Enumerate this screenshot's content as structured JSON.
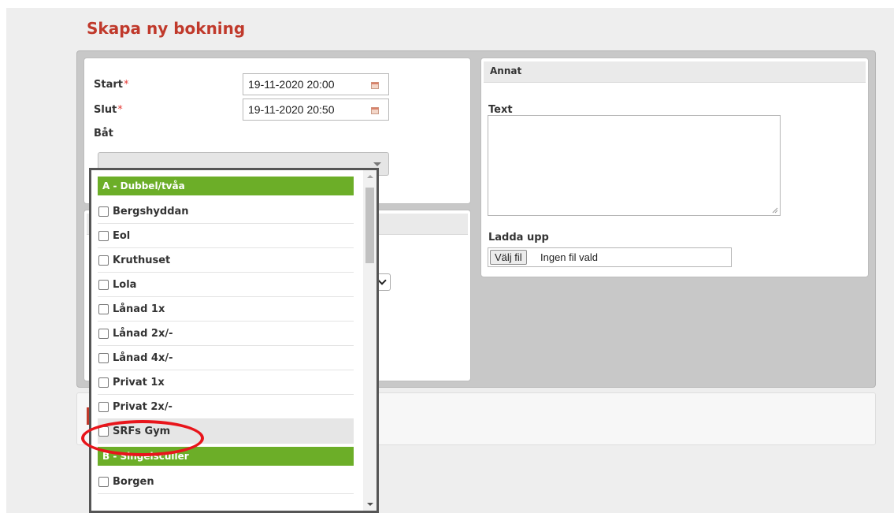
{
  "page": {
    "title": "Skapa ny bokning"
  },
  "booking": {
    "start_label": "Start",
    "start_value": "19-11-2020 20:00",
    "slut_label": "Slut",
    "slut_value": "19-11-2020 20:50",
    "required_marker": "*",
    "bat_label": "Båt"
  },
  "annat": {
    "header": "Annat",
    "text_label": "Text",
    "text_value": "",
    "upload_label": "Ladda upp",
    "file_button": "Välj fil",
    "file_status": "Ingen fil vald"
  },
  "dropdown": {
    "groups": [
      {
        "label": "A - Dubbel/tvåa",
        "items": [
          "Bergshyddan",
          "Eol",
          "Kruthuset",
          "Lola",
          "Lånad 1x",
          "Lånad 2x/-",
          "Lånad 4x/-",
          "Privat 1x",
          "Privat 2x/-",
          "SRFs Gym"
        ]
      },
      {
        "label": "B - Singelsculler",
        "items": [
          "Borgen"
        ]
      }
    ],
    "highlighted_item": "SRFs Gym"
  },
  "colors": {
    "title": "#c0392b",
    "group_header": "#6cae28",
    "annotation_circle": "#e8151b"
  }
}
